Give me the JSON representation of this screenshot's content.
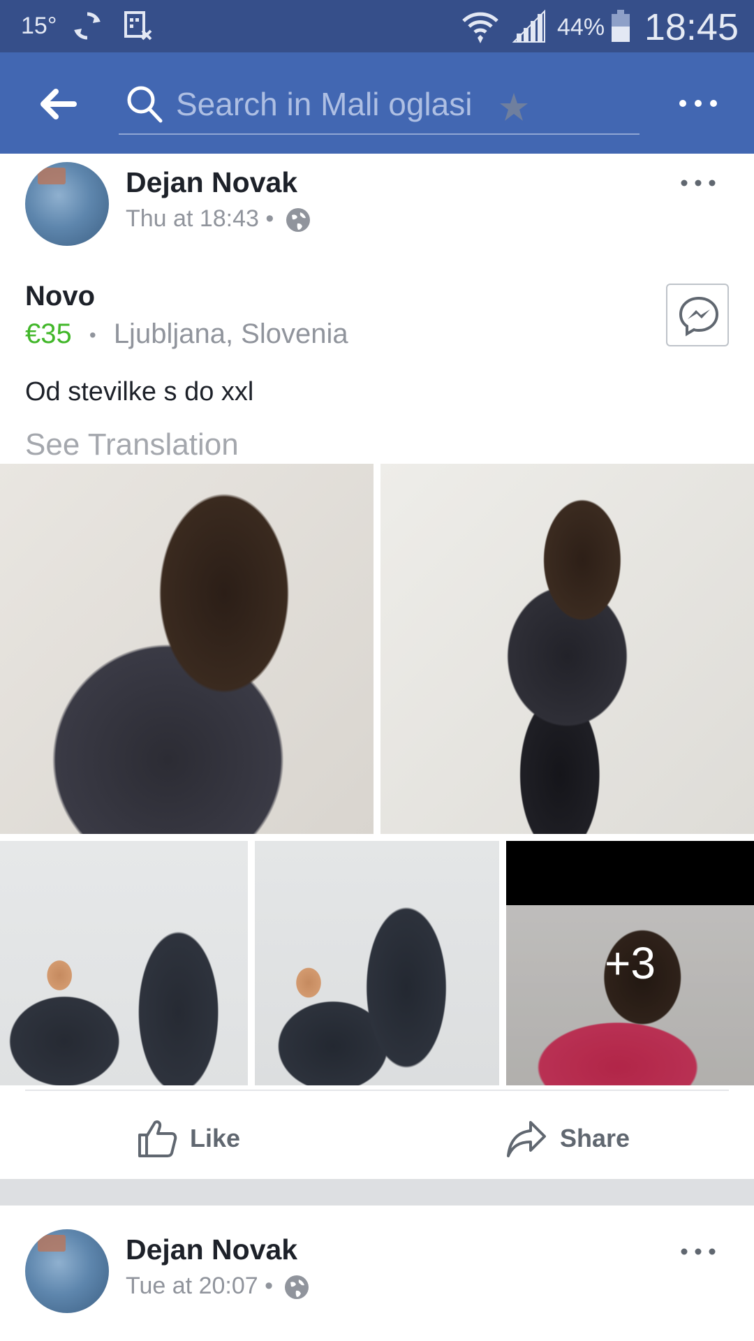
{
  "status_bar": {
    "temperature": "15°",
    "battery": "44%",
    "time": "18:45"
  },
  "search": {
    "placeholder": "Search in Mali oglasi"
  },
  "posts": [
    {
      "author": "Dejan Novak",
      "time": "Thu at 18:43 •",
      "title": "Novo",
      "price": "€35",
      "separator": "•",
      "location": "Ljubljana, Slovenia",
      "description": "Od stevilke s do xxl",
      "see_translation": "See Translation",
      "more_photos": "+3",
      "like_label": "Like",
      "share_label": "Share"
    },
    {
      "author": "Dejan Novak",
      "time": "Tue at 20:07 •"
    }
  ],
  "icons": {
    "back": "arrow-left-icon",
    "search": "search-icon",
    "more": "more-horizontal-icon",
    "globe": "globe-icon",
    "messenger": "messenger-icon",
    "like": "thumbs-up-icon",
    "share": "share-arrow-icon"
  },
  "colors": {
    "status_bar": "#364f8a",
    "app_bar": "#4267b2",
    "price": "#42b72a",
    "text_primary": "#1d2129",
    "text_secondary": "#90949c"
  }
}
